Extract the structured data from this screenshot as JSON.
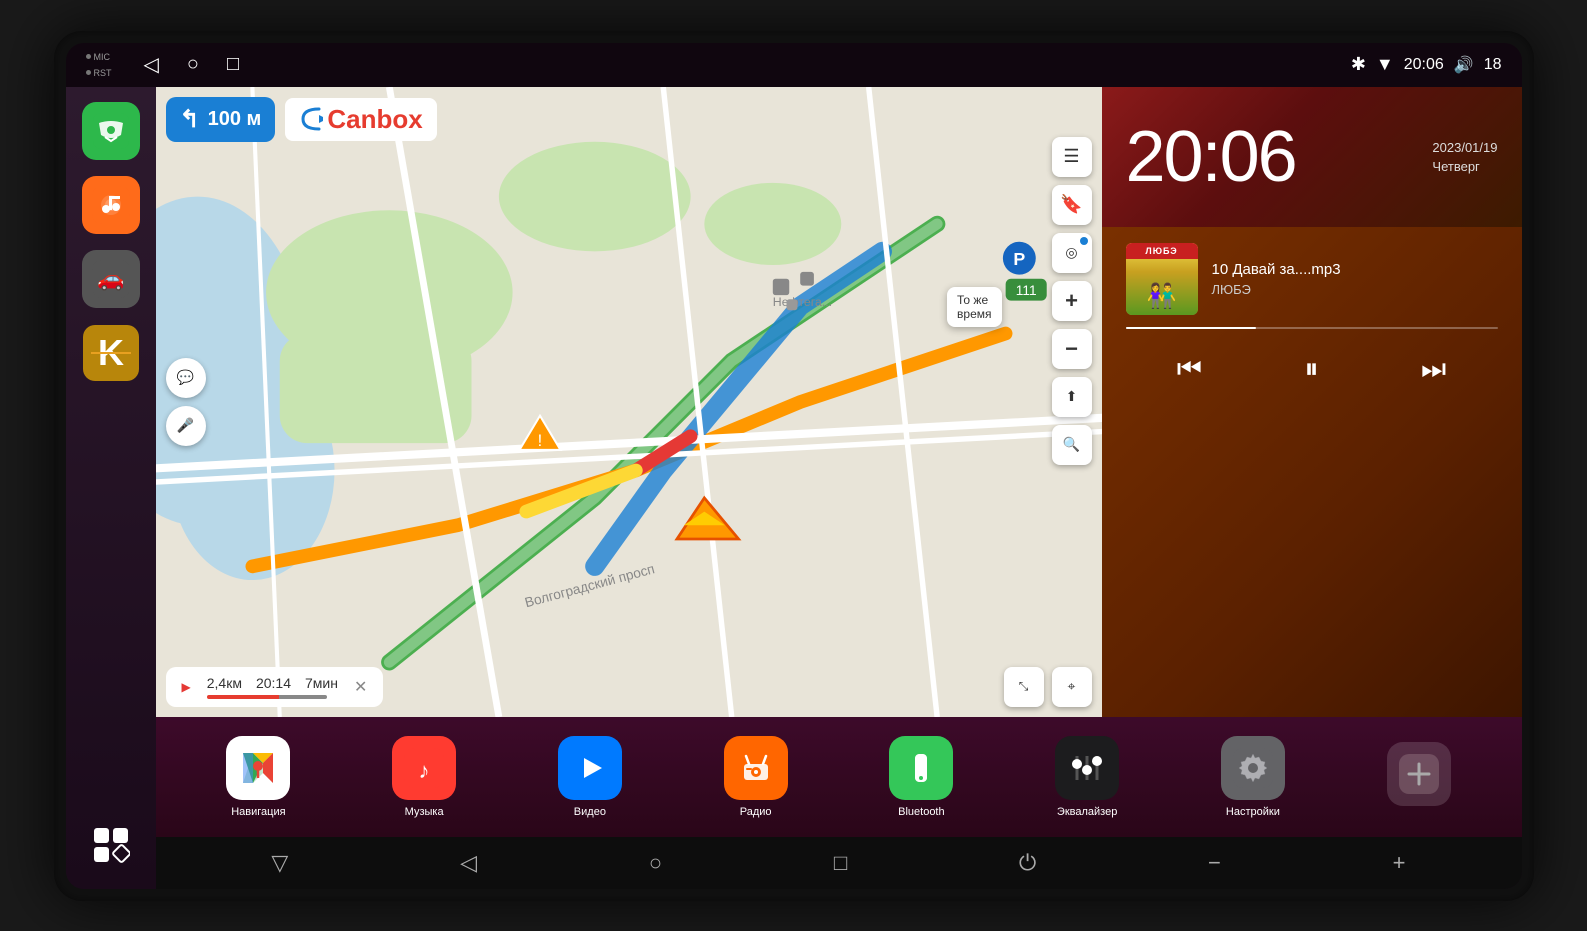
{
  "device": {
    "statusBar": {
      "time": "20:06",
      "volume": "18",
      "micLabel": "MIC",
      "rstLabel": "RST"
    },
    "clock": {
      "time": "20:06",
      "date": "2023/01/19",
      "day": "Четверг"
    },
    "music": {
      "trackName": "10 Давай за....mp3",
      "artist": "ЛЮБЭ",
      "albumTopText": "ЛЮБЭ"
    },
    "map": {
      "direction": "↰",
      "distance": "100 м",
      "logoText": "Canbox",
      "routeDistance": "2,4км",
      "routeTime": "20:14",
      "routeMinutes": "7мин",
      "tooltip": "То же\nвремя"
    },
    "dock": {
      "apps": [
        {
          "id": "navigation",
          "label": "Навигация",
          "icon": "📍"
        },
        {
          "id": "music",
          "label": "Музыка",
          "icon": "🎵"
        },
        {
          "id": "video",
          "label": "Видео",
          "icon": "▶"
        },
        {
          "id": "radio",
          "label": "Радио",
          "icon": "📻"
        },
        {
          "id": "bluetooth",
          "label": "Bluetooth",
          "icon": "🔷"
        },
        {
          "id": "equalizer",
          "label": "Эквалайзер",
          "icon": "⬛"
        },
        {
          "id": "settings",
          "label": "Настройки",
          "icon": "⚙"
        },
        {
          "id": "add",
          "label": "",
          "icon": "+"
        }
      ]
    },
    "bottomNav": {
      "buttons": [
        "▽",
        "◁",
        "○",
        "□",
        "⏻",
        "−",
        "+"
      ]
    }
  }
}
